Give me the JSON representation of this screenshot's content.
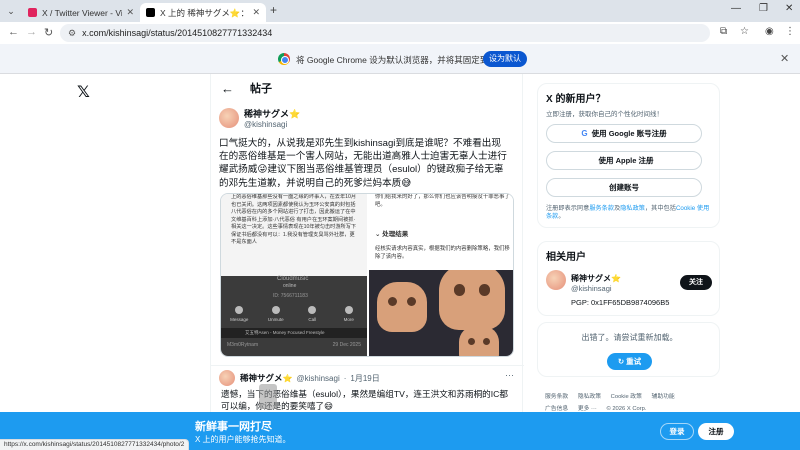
{
  "browser": {
    "tabs": [
      {
        "title": "X / Twitter Viewer - View Twi",
        "active": false,
        "favicon_color": "#e0245e"
      },
      {
        "title": "X 上的 稀神サグメ⭐：\"口气挺",
        "active": true,
        "favicon_color": "#000000"
      }
    ],
    "url": "x.com/kishinsagi/status/2014510827771332434",
    "infobar": {
      "message": "将 Google Chrome 设为默认浏览器，并将其固定到任务栏",
      "button": "设为默认"
    }
  },
  "post": {
    "header_title": "帖子",
    "author_name": "稀神サグメ",
    "author_handle": "@kishinsagi",
    "text": "口气挺大的，从说我是邓先生到kishinsagi到底是谁呢？不难看出现在的恶俗维基是一个害人网站，无能出道高雅人士迫害无辜人士进行耀武扬威😜建议下图当恶俗维基管理员（esulol）的键政痴子给无辜的邓先生道歉，并说明自己的死爹烂妈本质😅",
    "media": {
      "left_doc_text": "上的恶俗维基那些没有一面之缘的坏事人，在去年10月也已关闭。这两项因素都使我认为玉环公安真的封包括八代恶俗在内的多个网站进行了打击，因此搬运了在中文维基百科上添加·八代恶俗 有用户在玉环案期间被抓·相关这一决定。这些事情表现在10年被匀击时游所写下保证书后都没有可以：1.我没有管理支臭骂外社群，更不是东面人",
      "phone_title": "Cloudmusic",
      "phone_status": "online",
      "phone_id": "ID: 7566711183",
      "phone_actions": [
        "Message",
        "Unmute",
        "Call",
        "More"
      ],
      "music_line": "艾五特Asen - Money Focused Freestyle",
      "footer_user": "M3m0Rytnam",
      "footer_date": "29 Dec 2025",
      "quoted_text": "你们给我来的好了，那么你们也应该告明接没干罪恶事了吧。",
      "result_title": "处理结果",
      "result_text": "经核实请求内容真实，根据我们的内容删除策略，我们移除了该内容。"
    }
  },
  "reply": {
    "author_name": "稀神サグメ",
    "author_handle": "@kishinsagi",
    "date": "1月19日",
    "text": "遗憾，当下的恶俗维基（esulol），果然是编组TV，连王洪文和苏雨桐的IC都可以编，你还是的要笑嘻了😄"
  },
  "sidebar": {
    "signup_title": "X 的新用户？",
    "signup_subtitle": "立即注册，获取你自己的个性化时间线！",
    "google_btn": "使用 Google 账号注册",
    "apple_btn": "使用 Apple 注册",
    "create_btn": "创建账号",
    "terms_prefix": "注册即表示同意",
    "terms_link1": "服务条款",
    "terms_mid": "及",
    "terms_link2": "隐私政策",
    "terms_mid2": "，其中包括",
    "terms_link3": "Cookie 使用条款",
    "terms_end": "。",
    "related_title": "相关用户",
    "related_name": "稀神サグメ",
    "related_handle": "@kishinsagi",
    "related_bio": "PGP: 0x1FF65DB9874096B5",
    "follow_label": "关注",
    "error_text": "出错了。请尝试重新加载。",
    "retry_label": "重试",
    "footer_links": [
      "服务条款",
      "隐私政策",
      "Cookie 政策",
      "辅助功能",
      "广告信息",
      "更多 ···",
      "© 2026 X Corp."
    ]
  },
  "loginbar": {
    "title": "新鲜事一网打尽",
    "subtitle": "X 上的用户能够抢先知道。",
    "login": "登录",
    "signup": "注册"
  },
  "status_url": "https://x.com/kishinsagi/status/2014510827771332434/photo/2",
  "colors": {
    "accent": "#1d9bf0",
    "chrome_blue": "#0b57d0",
    "star": "#f5a623"
  }
}
